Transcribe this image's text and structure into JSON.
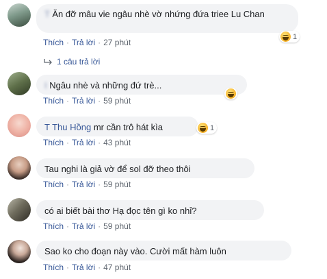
{
  "comments": [
    {
      "name": "T           ",
      "text": "Ăn đỡ mâu vie ngâu nhè vờ nhứng đứa triee Lu Chan",
      "reaction_count": "1",
      "actions": {
        "like": "Thích",
        "reply": "Trả lời",
        "time": "27 phút"
      },
      "replies": "1 câu trả lời"
    },
    {
      "name": "I                       ",
      "text": "Ngâu nhè và những đứ trè...",
      "reaction_count": "",
      "actions": {
        "like": "Thích",
        "reply": "Trả lời",
        "time": "59 phút"
      }
    },
    {
      "name": "T           Thu Hồng",
      "text": "mr cần trô hát kìa",
      "reaction_count": "1",
      "actions": {
        "like": "Thích",
        "reply": "Trả lời",
        "time": "43 phút"
      }
    },
    {
      "name": "              ",
      "text": "Tau nghi là giả vờ để sol đỡ theo thôi",
      "reaction_count": "",
      "actions": {
        "like": "Thích",
        "reply": "Trả lời",
        "time": "59 phút"
      }
    },
    {
      "name": "               ",
      "text": "có ai biết bài thơ Hạ đọc tên gì ko nhỉ?",
      "reaction_count": "",
      "actions": {
        "like": "Thích",
        "reply": "Trả lời",
        "time": "59 phút"
      }
    },
    {
      "name": "                ",
      "text": "Sao ko cho đoạn này vào. Cười mất hàm luôn",
      "reaction_count": "",
      "actions": {
        "like": "Thích",
        "reply": "Trả lời",
        "time": "47 phút"
      }
    }
  ],
  "colors": {
    "link": "#385898",
    "bubble": "#f2f3f5",
    "meta": "#606770"
  }
}
